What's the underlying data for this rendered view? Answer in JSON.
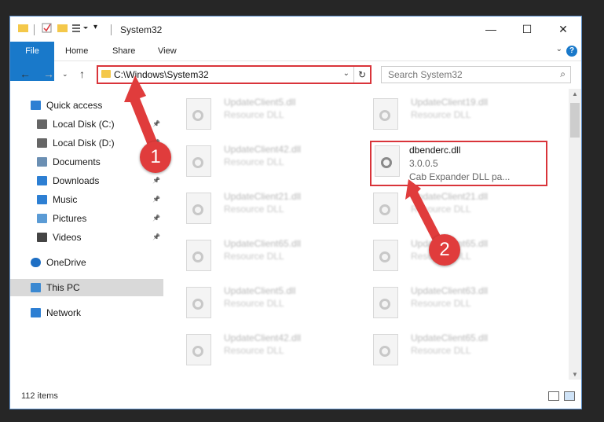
{
  "window": {
    "title": "System32",
    "minimize": "—",
    "maximize": "☐",
    "close": "✕"
  },
  "ribbon": {
    "tabs": [
      "File",
      "Home",
      "Share",
      "View"
    ],
    "help": "?"
  },
  "address": {
    "path": "C:\\Windows\\System32",
    "search_placeholder": "Search System32"
  },
  "sidebar": {
    "items": [
      {
        "label": "Quick access",
        "icon": "star-icon",
        "pinned": false
      },
      {
        "label": "Local Disk (C:)",
        "icon": "drive-icon",
        "pinned": true
      },
      {
        "label": "Local Disk (D:)",
        "icon": "drive-icon",
        "pinned": true
      },
      {
        "label": "Documents",
        "icon": "documents-icon",
        "pinned": true
      },
      {
        "label": "Downloads",
        "icon": "downloads-icon",
        "pinned": true
      },
      {
        "label": "Music",
        "icon": "music-icon",
        "pinned": true
      },
      {
        "label": "Pictures",
        "icon": "pictures-icon",
        "pinned": true
      },
      {
        "label": "Videos",
        "icon": "videos-icon",
        "pinned": true
      },
      {
        "label": "OneDrive",
        "icon": "cloud-icon",
        "pinned": false
      },
      {
        "label": "This PC",
        "icon": "pc-icon",
        "pinned": false,
        "selected": true
      },
      {
        "label": "Network",
        "icon": "network-icon",
        "pinned": false
      }
    ]
  },
  "files": {
    "left": [
      {
        "name": "UpdateClient5.dll",
        "type": "Resource DLL"
      },
      {
        "name": "UpdateClient42.dll",
        "type": "Resource DLL"
      },
      {
        "name": "UpdateClient21.dll",
        "type": "Resource DLL"
      },
      {
        "name": "UpdateClient65.dll",
        "type": "Resource DLL"
      },
      {
        "name": "UpdateClient5.dll",
        "type": "Resource DLL"
      },
      {
        "name": "UpdateClient42.dll",
        "type": "Resource DLL"
      }
    ],
    "right": [
      {
        "name": "UpdateClient19.dll",
        "type": "Resource DLL"
      },
      {
        "name": "dbenderc.dll",
        "version": "3.0.0.5",
        "type": "Cab Expander DLL pa...",
        "highlighted": true
      },
      {
        "name": "UpdateClient21.dll",
        "type": "Resource DLL"
      },
      {
        "name": "UpdateClient65.dll",
        "type": "Resource DLL"
      },
      {
        "name": "UpdateClient63.dll",
        "type": "Resource DLL"
      },
      {
        "name": "UpdateClient65.dll",
        "type": "Resource DLL"
      }
    ]
  },
  "status": {
    "item_count": "112 items"
  },
  "annotations": {
    "step1": "1",
    "step2": "2",
    "color": "#e03c3c"
  }
}
